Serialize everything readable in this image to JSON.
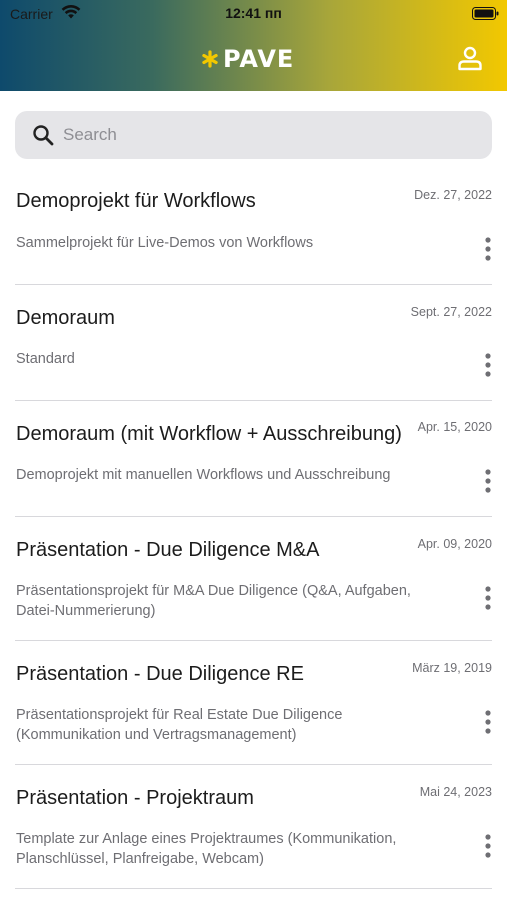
{
  "status_bar": {
    "carrier": "Carrier",
    "time": "12:41 пп"
  },
  "header": {
    "logo_text": "PAVE",
    "logo_color": "#f2c800"
  },
  "search": {
    "placeholder": "Search",
    "value": ""
  },
  "projects": [
    {
      "title": "Demoprojekt für Workflows",
      "date": "Dez. 27, 2022",
      "description": "Sammelprojekt für Live-Demos von Workflows"
    },
    {
      "title": "Demoraum",
      "date": "Sept. 27, 2022",
      "description": "Standard"
    },
    {
      "title": "Demoraum (mit Workflow + Ausschreibung)",
      "date": "Apr. 15, 2020",
      "description": "Demoprojekt mit manuellen Workflows und Ausschreibung"
    },
    {
      "title": "Präsentation - Due Diligence M&A",
      "date": "Apr. 09, 2020",
      "description": "Präsentationsprojekt für M&A Due Diligence (Q&A, Aufgaben, Datei-Nummerierung)"
    },
    {
      "title": "Präsentation - Due Diligence RE",
      "date": "März 19, 2019",
      "description": "Präsentationsprojekt für Real Estate Due Diligence (Kommunikation und Vertragsmanagement)"
    },
    {
      "title": "Präsentation - Projektraum",
      "date": "Mai 24, 2023",
      "description": "Template zur Anlage eines Projektraumes (Kommunikation, Planschlüssel, Planfreigabe, Webcam)"
    }
  ]
}
